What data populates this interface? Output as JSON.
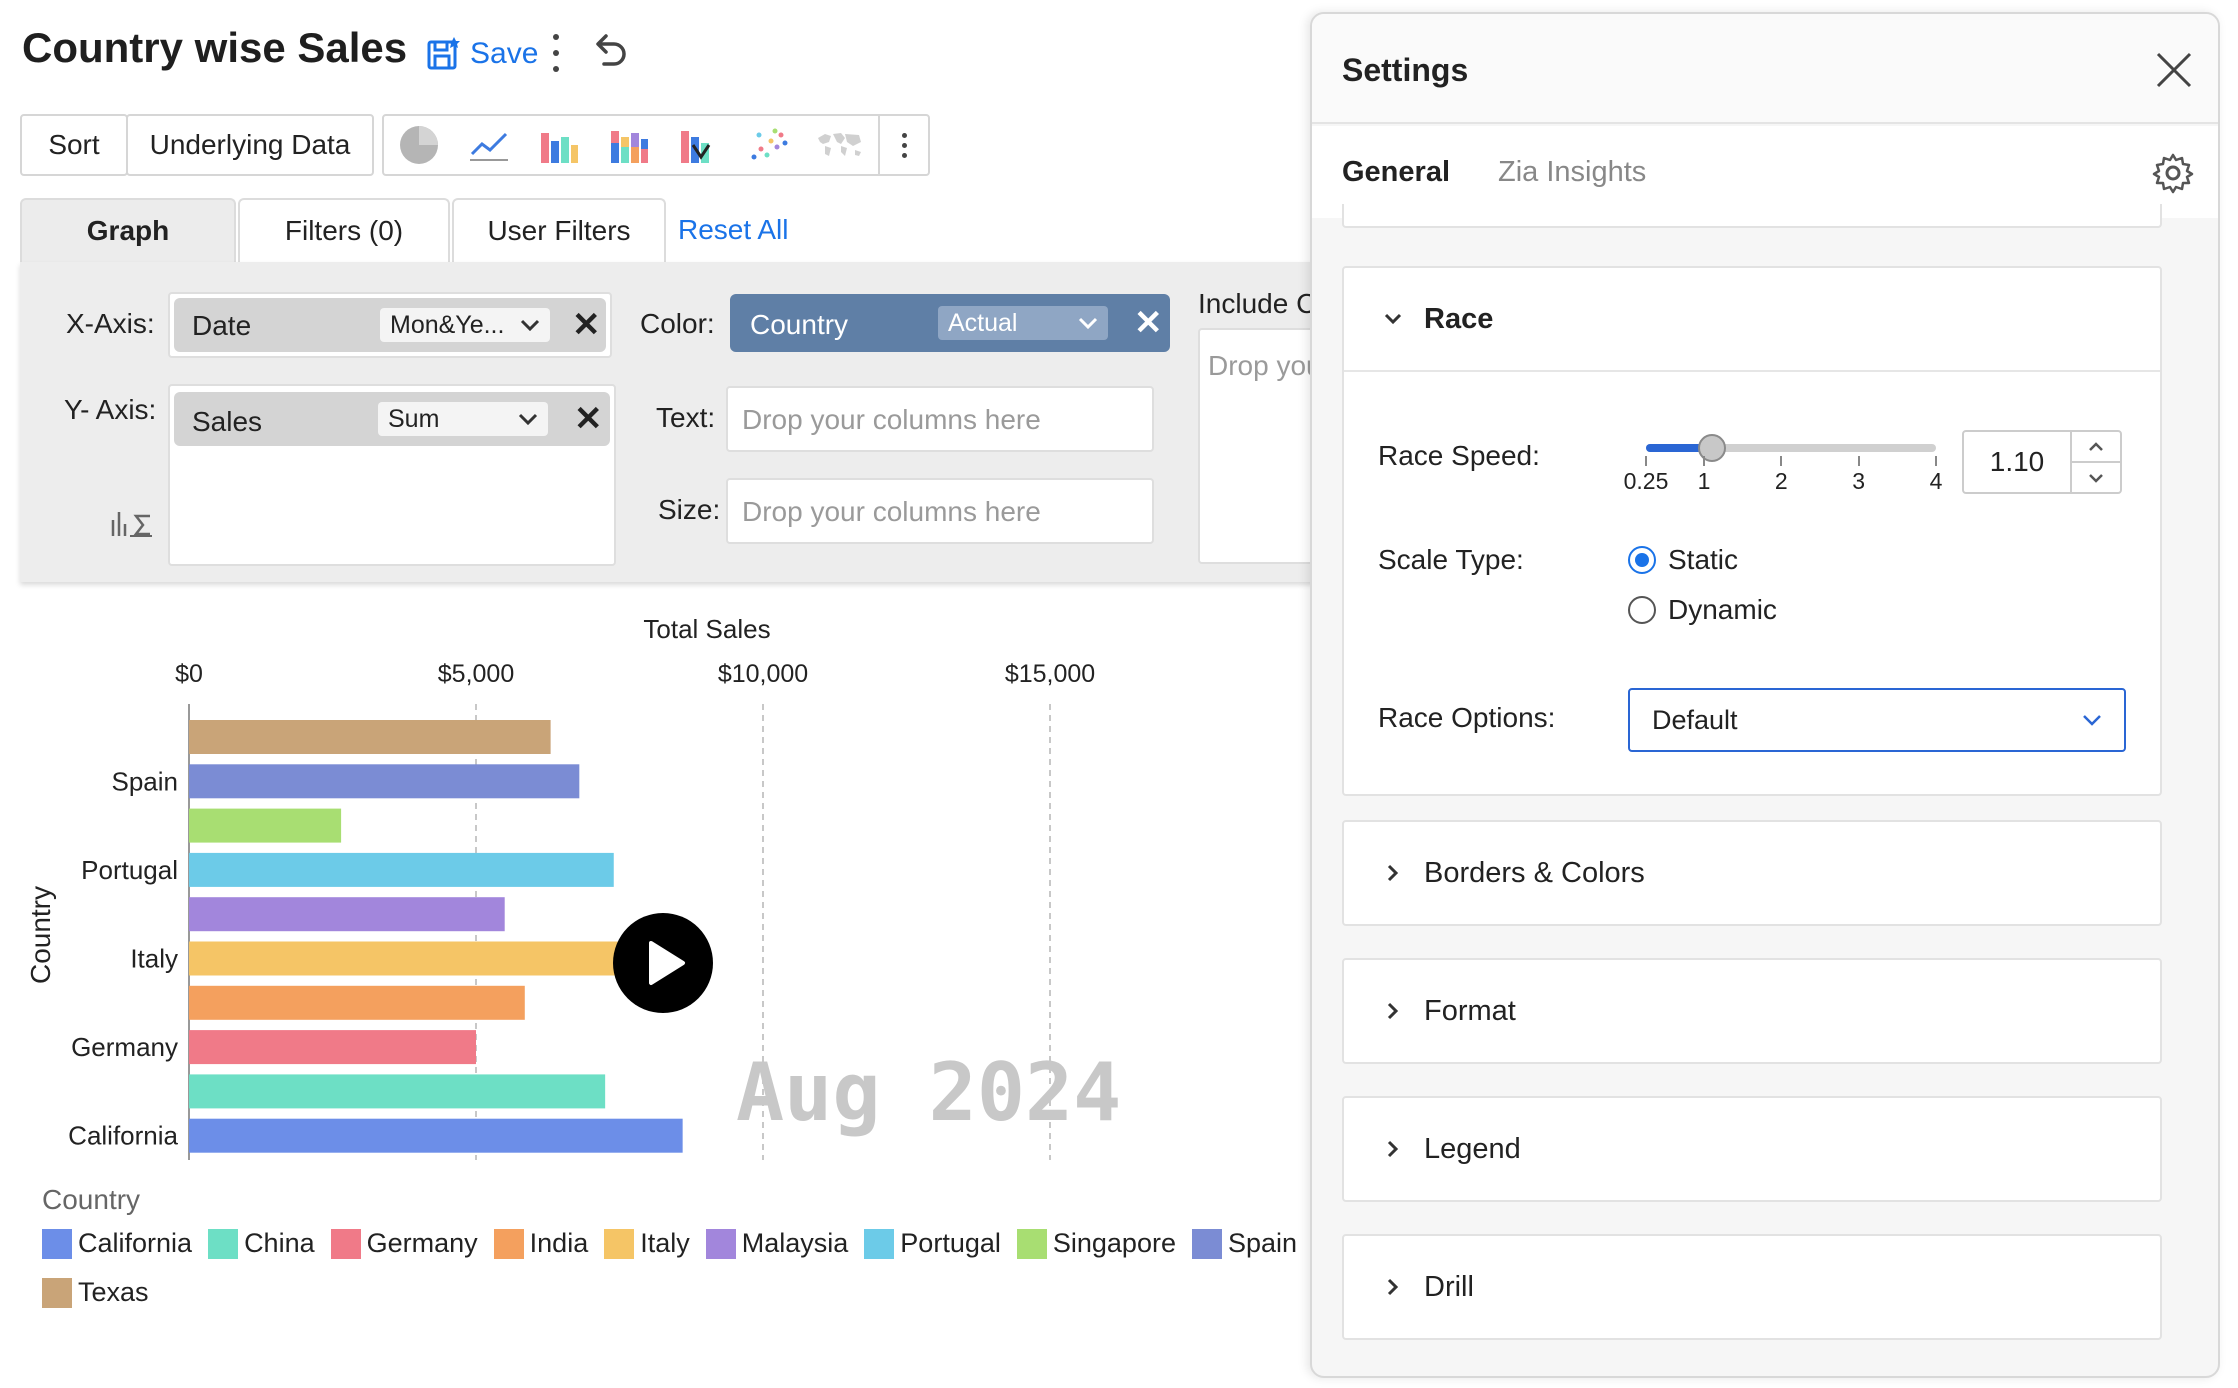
{
  "header": {
    "title": "Country wise Sales",
    "save_label": "Save"
  },
  "toolbar": {
    "sort_label": "Sort",
    "underlying_label": "Underlying Data",
    "chart_type_icons": [
      "pie-chart-icon",
      "line-chart-icon",
      "bar-chart-icon",
      "stacked-bar-icon",
      "waterfall-icon",
      "scatter-icon",
      "map-icon"
    ]
  },
  "tabs": {
    "graph": "Graph",
    "filters": "Filters  (0)",
    "user_filters": "User Filters",
    "reset_all": "Reset All"
  },
  "config": {
    "x_axis_label": "X-Axis:",
    "x_axis_column": "Date",
    "x_axis_function": "Mon&Ye...",
    "y_axis_label": "Y- Axis:",
    "y_axis_column": "Sales",
    "y_axis_function": "Sum",
    "color_label": "Color:",
    "color_column": "Country",
    "color_function": "Actual",
    "text_label": "Text:",
    "size_label": "Size:",
    "drop_hint": "Drop your columns here",
    "include_label": "Include C",
    "include_hint": "Drop you"
  },
  "chart_data": {
    "type": "bar",
    "orientation": "horizontal",
    "title": "Total Sales",
    "xlabel": "Total Sales",
    "ylabel": "Country",
    "xlim": [
      0,
      17000
    ],
    "x_ticks": [
      0,
      5000,
      10000,
      15000
    ],
    "x_tick_labels": [
      "$0",
      "$5,000",
      "$10,000",
      "$15,000"
    ],
    "y_tick_labels": [
      "Spain",
      "Portugal",
      "Italy",
      "Germany",
      "California"
    ],
    "bars": [
      {
        "category": "Texas",
        "value": 6300,
        "color": "#c9a478"
      },
      {
        "category": "Spain",
        "value": 6800,
        "color": "#7b8cd4"
      },
      {
        "category": "Singapore",
        "value": 2650,
        "color": "#a8de72"
      },
      {
        "category": "Portugal",
        "value": 7400,
        "color": "#6ccbe8"
      },
      {
        "category": "Malaysia",
        "value": 5500,
        "color": "#a286dc"
      },
      {
        "category": "Italy",
        "value": 8700,
        "color": "#f5c566"
      },
      {
        "category": "India",
        "value": 5850,
        "color": "#f4a05e"
      },
      {
        "category": "Germany",
        "value": 5000,
        "color": "#f07a88"
      },
      {
        "category": "China",
        "value": 7250,
        "color": "#6ddfc5"
      },
      {
        "category": "California",
        "value": 8600,
        "color": "#6c8ee8"
      }
    ],
    "grid": true,
    "legend_title": "Country",
    "legend_placement": "bottom",
    "legend": [
      {
        "name": "California",
        "color": "#6c8ee8"
      },
      {
        "name": "China",
        "color": "#6ddfc5"
      },
      {
        "name": "Germany",
        "color": "#f07a88"
      },
      {
        "name": "India",
        "color": "#f4a05e"
      },
      {
        "name": "Italy",
        "color": "#f5c566"
      },
      {
        "name": "Malaysia",
        "color": "#a286dc"
      },
      {
        "name": "Portugal",
        "color": "#6ccbe8"
      },
      {
        "name": "Singapore",
        "color": "#a8de72"
      },
      {
        "name": "Spain",
        "color": "#7b8cd4"
      },
      {
        "name": "Texas",
        "color": "#c9a478"
      }
    ],
    "frame_label": "Aug 2024"
  },
  "settings": {
    "title": "Settings",
    "tab_general": "General",
    "tab_zia": "Zia Insights",
    "race": {
      "section_label": "Race",
      "speed_label": "Race Speed:",
      "speed_value": "1.10",
      "speed_min": 0.25,
      "speed_max": 4,
      "speed_numeric": 1.1,
      "speed_ticks": [
        "0.25",
        "1",
        "2",
        "3",
        "4"
      ],
      "scale_label": "Scale Type:",
      "scale_options": [
        "Static",
        "Dynamic"
      ],
      "scale_selected": "Static",
      "options_label": "Race Options:",
      "options_value": "Default"
    },
    "sections": [
      "Borders & Colors",
      "Format",
      "Legend",
      "Drill"
    ]
  },
  "colors": {
    "accent": "#1a73e8",
    "color_pill": "#5f7fa6"
  }
}
